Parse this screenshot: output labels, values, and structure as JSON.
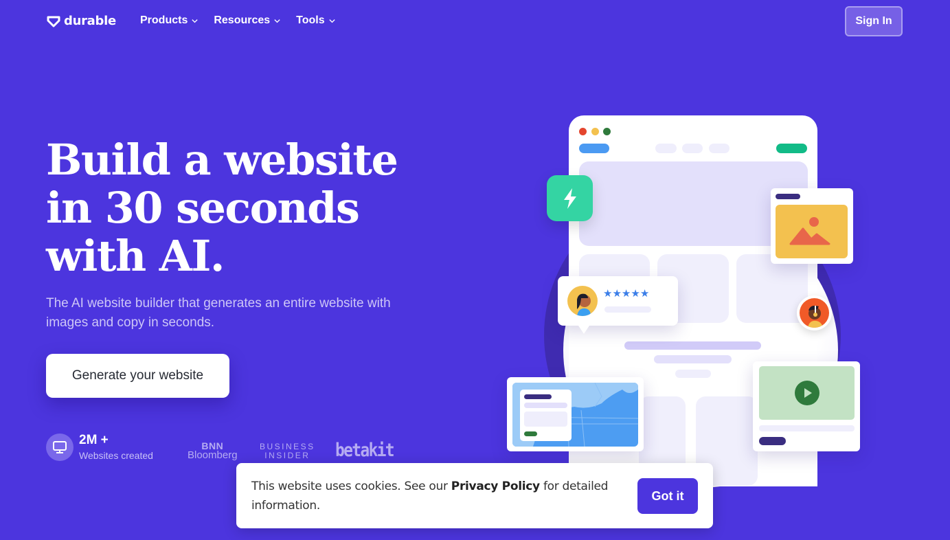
{
  "nav": {
    "logo_text": "durable",
    "menu": [
      {
        "label": "Products"
      },
      {
        "label": "Resources"
      },
      {
        "label": "Tools"
      }
    ],
    "sign_in_label": "Sign In"
  },
  "hero": {
    "headline_lines": [
      "Build a website",
      "in 30 seconds",
      "with AI."
    ],
    "subtitle": "The AI website builder that generates an entire website with images and copy in seconds.",
    "cta_label": "Generate your website",
    "stat": {
      "value": "2M +",
      "label": "Websites created",
      "icon": "monitor-icon"
    },
    "press": {
      "bnn_line1": "BNN",
      "bnn_line2": "Bloomberg",
      "bi_line1": "BUSINESS",
      "bi_line2": "INSIDER",
      "betakit": "betakit"
    }
  },
  "illustration": {
    "rating_stars": 5,
    "colors": {
      "brand": "#4c35de",
      "green_tile": "#34d4a3",
      "image_card": "#f3c14f",
      "video_card": "#c3e2c4",
      "map": "#4d9df2"
    }
  },
  "cookie_banner": {
    "text_before": "This website uses cookies. See our ",
    "link_text": "Privacy Policy",
    "text_after": " for detailed information.",
    "button_label": "Got it"
  }
}
